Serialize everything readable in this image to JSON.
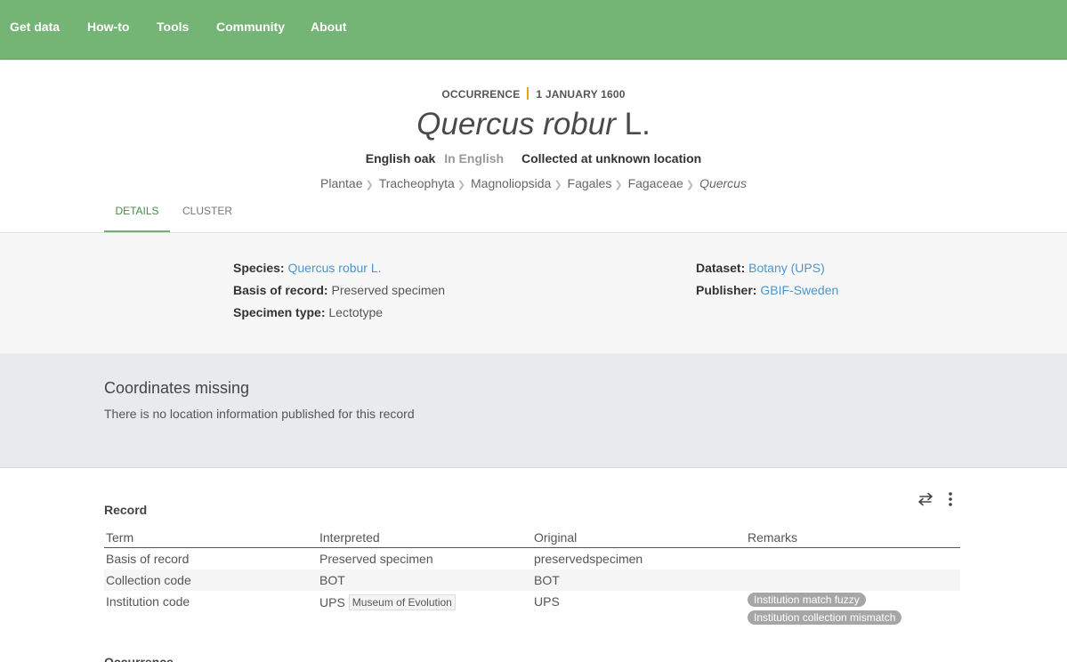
{
  "nav": {
    "items": [
      "Get data",
      "How-to",
      "Tools",
      "Community",
      "About"
    ]
  },
  "header": {
    "kicker_type": "OCCURRENCE",
    "kicker_date": "1 JANUARY 1600",
    "title_italic": "Quercus robur",
    "title_author": "L.",
    "vernacular": "English oak",
    "language": "In English",
    "location": "Collected at unknown location",
    "breadcrumb": [
      "Plantae",
      "Tracheophyta",
      "Magnoliopsida",
      "Fagales",
      "Fagaceae"
    ],
    "breadcrumb_genus": "Quercus",
    "tabs": [
      "DETAILS",
      "CLUSTER"
    ],
    "active_tab": "DETAILS"
  },
  "summary": {
    "species_label": "Species:",
    "species_value": "Quercus robur L.",
    "basis_label": "Basis of record:",
    "basis_value": "Preserved specimen",
    "specimen_label": "Specimen type:",
    "specimen_value": "Lectotype",
    "dataset_label": "Dataset:",
    "dataset_value": "Botany (UPS)",
    "publisher_label": "Publisher:",
    "publisher_value": "GBIF-Sweden"
  },
  "coords": {
    "title": "Coordinates missing",
    "text": "There is no location information published for this record"
  },
  "record": {
    "title": "Record",
    "icons": [
      "swap-icon",
      "more-vertical-icon"
    ],
    "headers": [
      "Term",
      "Interpreted",
      "Original",
      "Remarks"
    ],
    "rows": [
      {
        "term": "Basis of record",
        "interpreted": "Preserved specimen",
        "original": "preservedspecimen"
      },
      {
        "term": "Collection code",
        "interpreted": "BOT",
        "original": "BOT"
      },
      {
        "term": "Institution code",
        "interpreted": "UPS",
        "interpreted_tag": "Museum of Evolution",
        "original": "UPS",
        "remarks": [
          "Institution match fuzzy",
          "Institution collection mismatch"
        ]
      }
    ],
    "next_section": "Occurrence"
  }
}
